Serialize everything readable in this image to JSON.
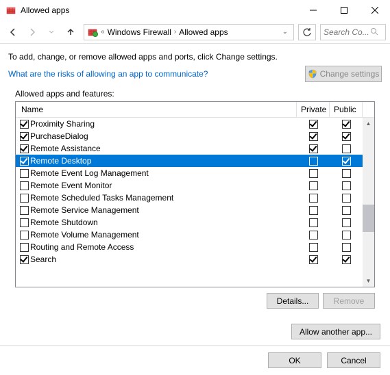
{
  "window": {
    "title": "Allowed apps"
  },
  "breadcrumb": {
    "item1": "Windows Firewall",
    "item2": "Allowed apps"
  },
  "search": {
    "placeholder": "Search Co..."
  },
  "intro": "To add, change, or remove allowed apps and ports, click Change settings.",
  "risk_link": "What are the risks of allowing an app to communicate?",
  "change_settings_label": "Change settings",
  "group_label": "Allowed apps and features:",
  "columns": {
    "name": "Name",
    "private": "Private",
    "public": "Public"
  },
  "apps": [
    {
      "name": "Proximity Sharing",
      "enabled": true,
      "private": true,
      "public": true,
      "selected": false
    },
    {
      "name": "PurchaseDialog",
      "enabled": true,
      "private": true,
      "public": true,
      "selected": false
    },
    {
      "name": "Remote Assistance",
      "enabled": true,
      "private": true,
      "public": false,
      "selected": false
    },
    {
      "name": "Remote Desktop",
      "enabled": true,
      "private": false,
      "public": true,
      "selected": true
    },
    {
      "name": "Remote Event Log Management",
      "enabled": false,
      "private": false,
      "public": false,
      "selected": false
    },
    {
      "name": "Remote Event Monitor",
      "enabled": false,
      "private": false,
      "public": false,
      "selected": false
    },
    {
      "name": "Remote Scheduled Tasks Management",
      "enabled": false,
      "private": false,
      "public": false,
      "selected": false
    },
    {
      "name": "Remote Service Management",
      "enabled": false,
      "private": false,
      "public": false,
      "selected": false
    },
    {
      "name": "Remote Shutdown",
      "enabled": false,
      "private": false,
      "public": false,
      "selected": false
    },
    {
      "name": "Remote Volume Management",
      "enabled": false,
      "private": false,
      "public": false,
      "selected": false
    },
    {
      "name": "Routing and Remote Access",
      "enabled": false,
      "private": false,
      "public": false,
      "selected": false
    },
    {
      "name": "Search",
      "enabled": true,
      "private": true,
      "public": true,
      "selected": false
    }
  ],
  "buttons": {
    "details": "Details...",
    "remove": "Remove",
    "allow_another": "Allow another app...",
    "ok": "OK",
    "cancel": "Cancel"
  }
}
